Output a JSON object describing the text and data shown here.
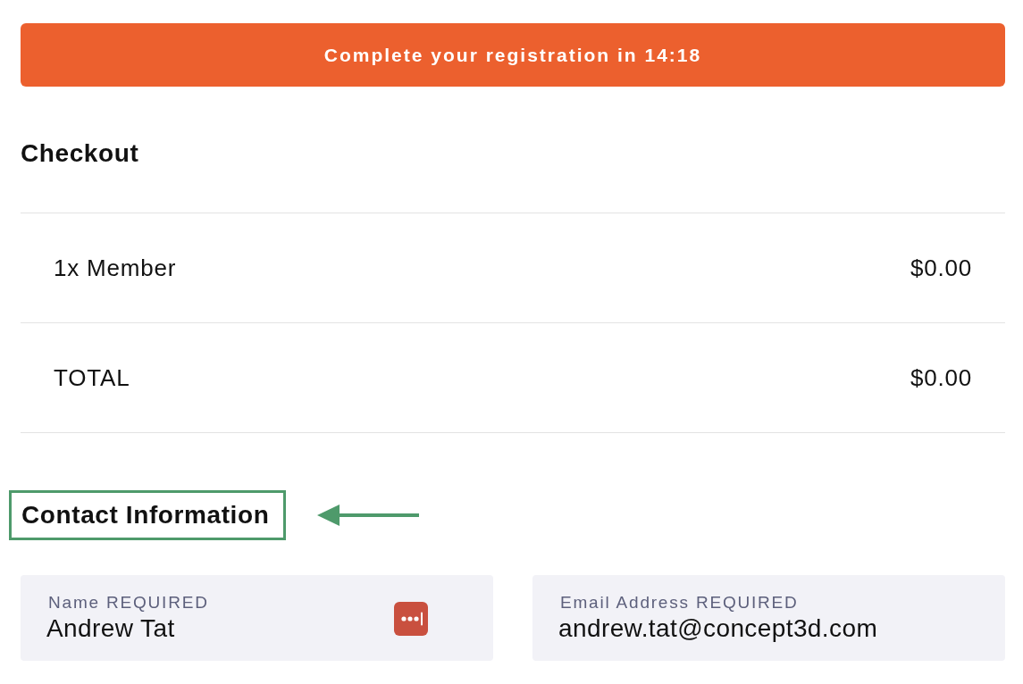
{
  "timer_banner": {
    "text": "Complete your registration in 14:18"
  },
  "checkout": {
    "title": "Checkout",
    "rows": [
      {
        "label": "1x Member",
        "amount": "$0.00"
      },
      {
        "label": "TOTAL",
        "amount": "$0.00"
      }
    ]
  },
  "contact": {
    "title": "Contact Information",
    "highlighted": true,
    "fields": [
      {
        "label": "Name",
        "required_tag": "REQUIRED",
        "value": "Andrew Tat",
        "autofill_icon": true
      },
      {
        "label": "Email Address",
        "required_tag": "REQUIRED",
        "value": "andrew.tat@concept3d.com",
        "autofill_icon": false
      }
    ]
  }
}
